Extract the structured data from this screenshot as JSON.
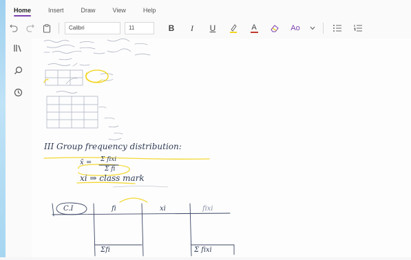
{
  "menu": {
    "tabs": [
      "Home",
      "Insert",
      "Draw",
      "View",
      "Help"
    ],
    "active": "Home"
  },
  "toolbar": {
    "font_name": "Calibri",
    "font_size": "11",
    "bold_label": "B",
    "italic_label": "I",
    "underline_label": "U",
    "font_color_label": "A",
    "styles_label": "Ao",
    "icons": [
      "undo-icon",
      "redo-icon",
      "clipboard-icon",
      "highlighter-icon",
      "font-color-icon",
      "eraser-icon",
      "styles-icon",
      "dropdown-icon",
      "bullet-list-icon",
      "numbered-list-icon"
    ],
    "accent_color": "#7a3fb0",
    "highlight_color": "#f2d41c",
    "font_color": "#c0392b"
  },
  "sidebar": {
    "icons": [
      "notebooks-icon",
      "search-icon",
      "recent-icon"
    ]
  },
  "note": {
    "heading": "III Group frequency distribution:",
    "formula_lhs": "x̄ =",
    "formula_num": "Σ fixi",
    "formula_den": "Σ fi",
    "class_mark": "xi ⇒ class mark",
    "table_headers": [
      "C.I",
      "fi",
      "xi",
      "fixi"
    ],
    "table_footers": [
      "Σfi",
      "Σ fixi"
    ]
  }
}
